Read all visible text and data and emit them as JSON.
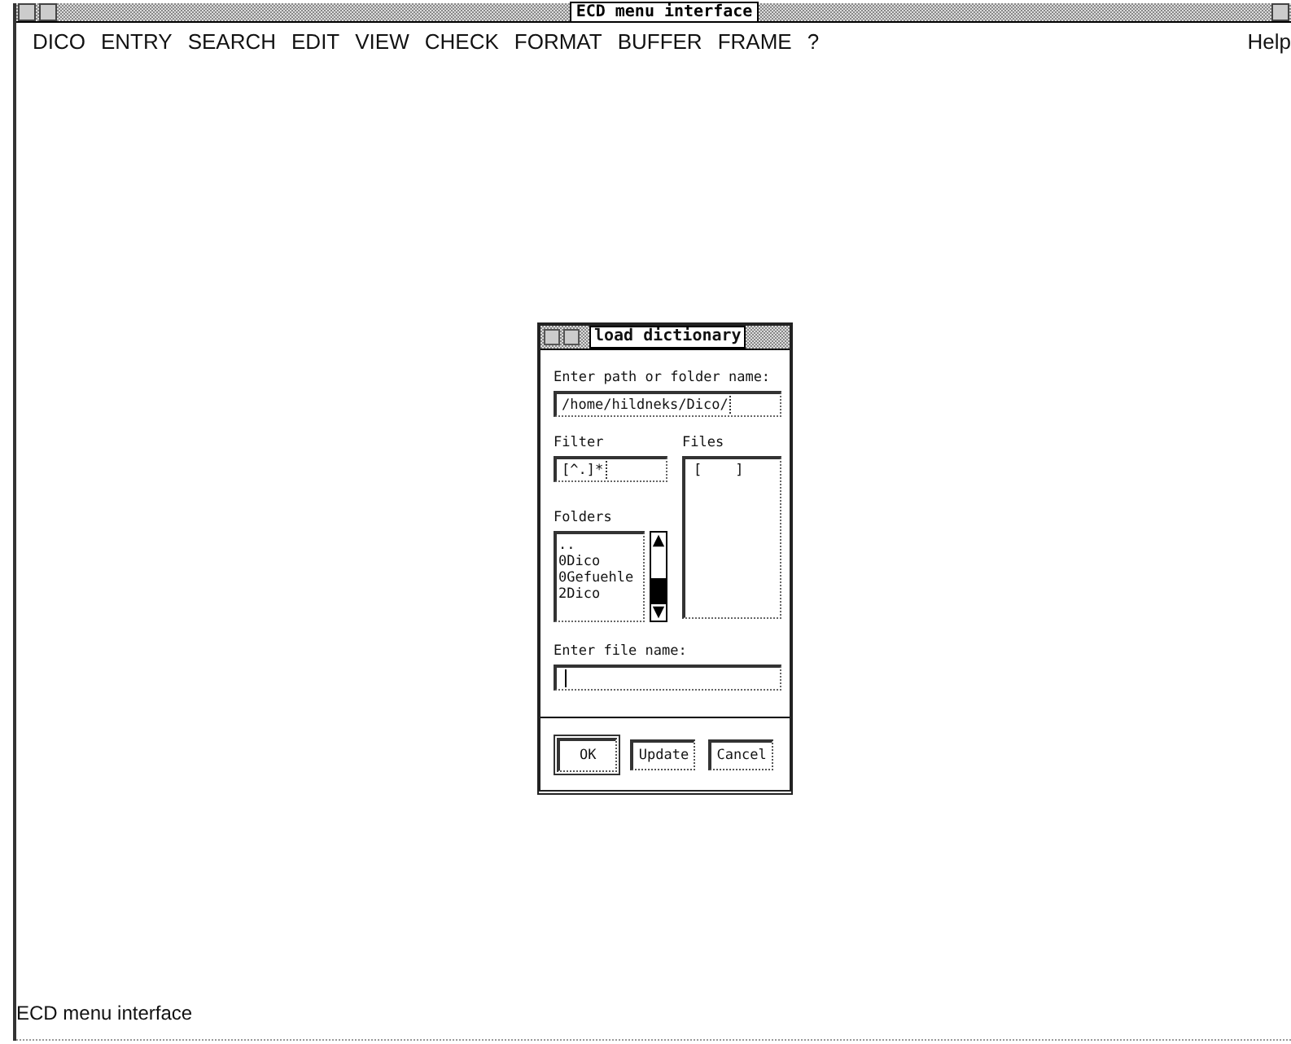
{
  "window": {
    "title": "ECD menu interface"
  },
  "menu": [
    {
      "label": "DICO"
    },
    {
      "label": "ENTRY"
    },
    {
      "label": "SEARCH"
    },
    {
      "label": "EDIT"
    },
    {
      "label": "VIEW"
    },
    {
      "label": "CHECK"
    },
    {
      "label": "FORMAT"
    },
    {
      "label": "BUFFER"
    },
    {
      "label": "FRAME"
    },
    {
      "label": "?"
    }
  ],
  "help": "Help",
  "dialog": {
    "title": "load dictionary",
    "path_label": "Enter path or folder name:",
    "path_value": "/home/hildneks/Dico/",
    "filter_label": "Filter",
    "filter_value": "[^.]*",
    "files_label": "Files",
    "files": [
      "[    ]"
    ],
    "folders_label": "Folders",
    "folders": [
      "..",
      "0Dico",
      "0Gefuehle",
      "2Dico"
    ],
    "file_name_label": "Enter file name:",
    "buttons": [
      {
        "label": "OK",
        "default": true
      },
      {
        "label": "Update",
        "default": false
      },
      {
        "label": "Cancel",
        "default": false
      }
    ]
  },
  "status_bar": "ECD menu interface"
}
